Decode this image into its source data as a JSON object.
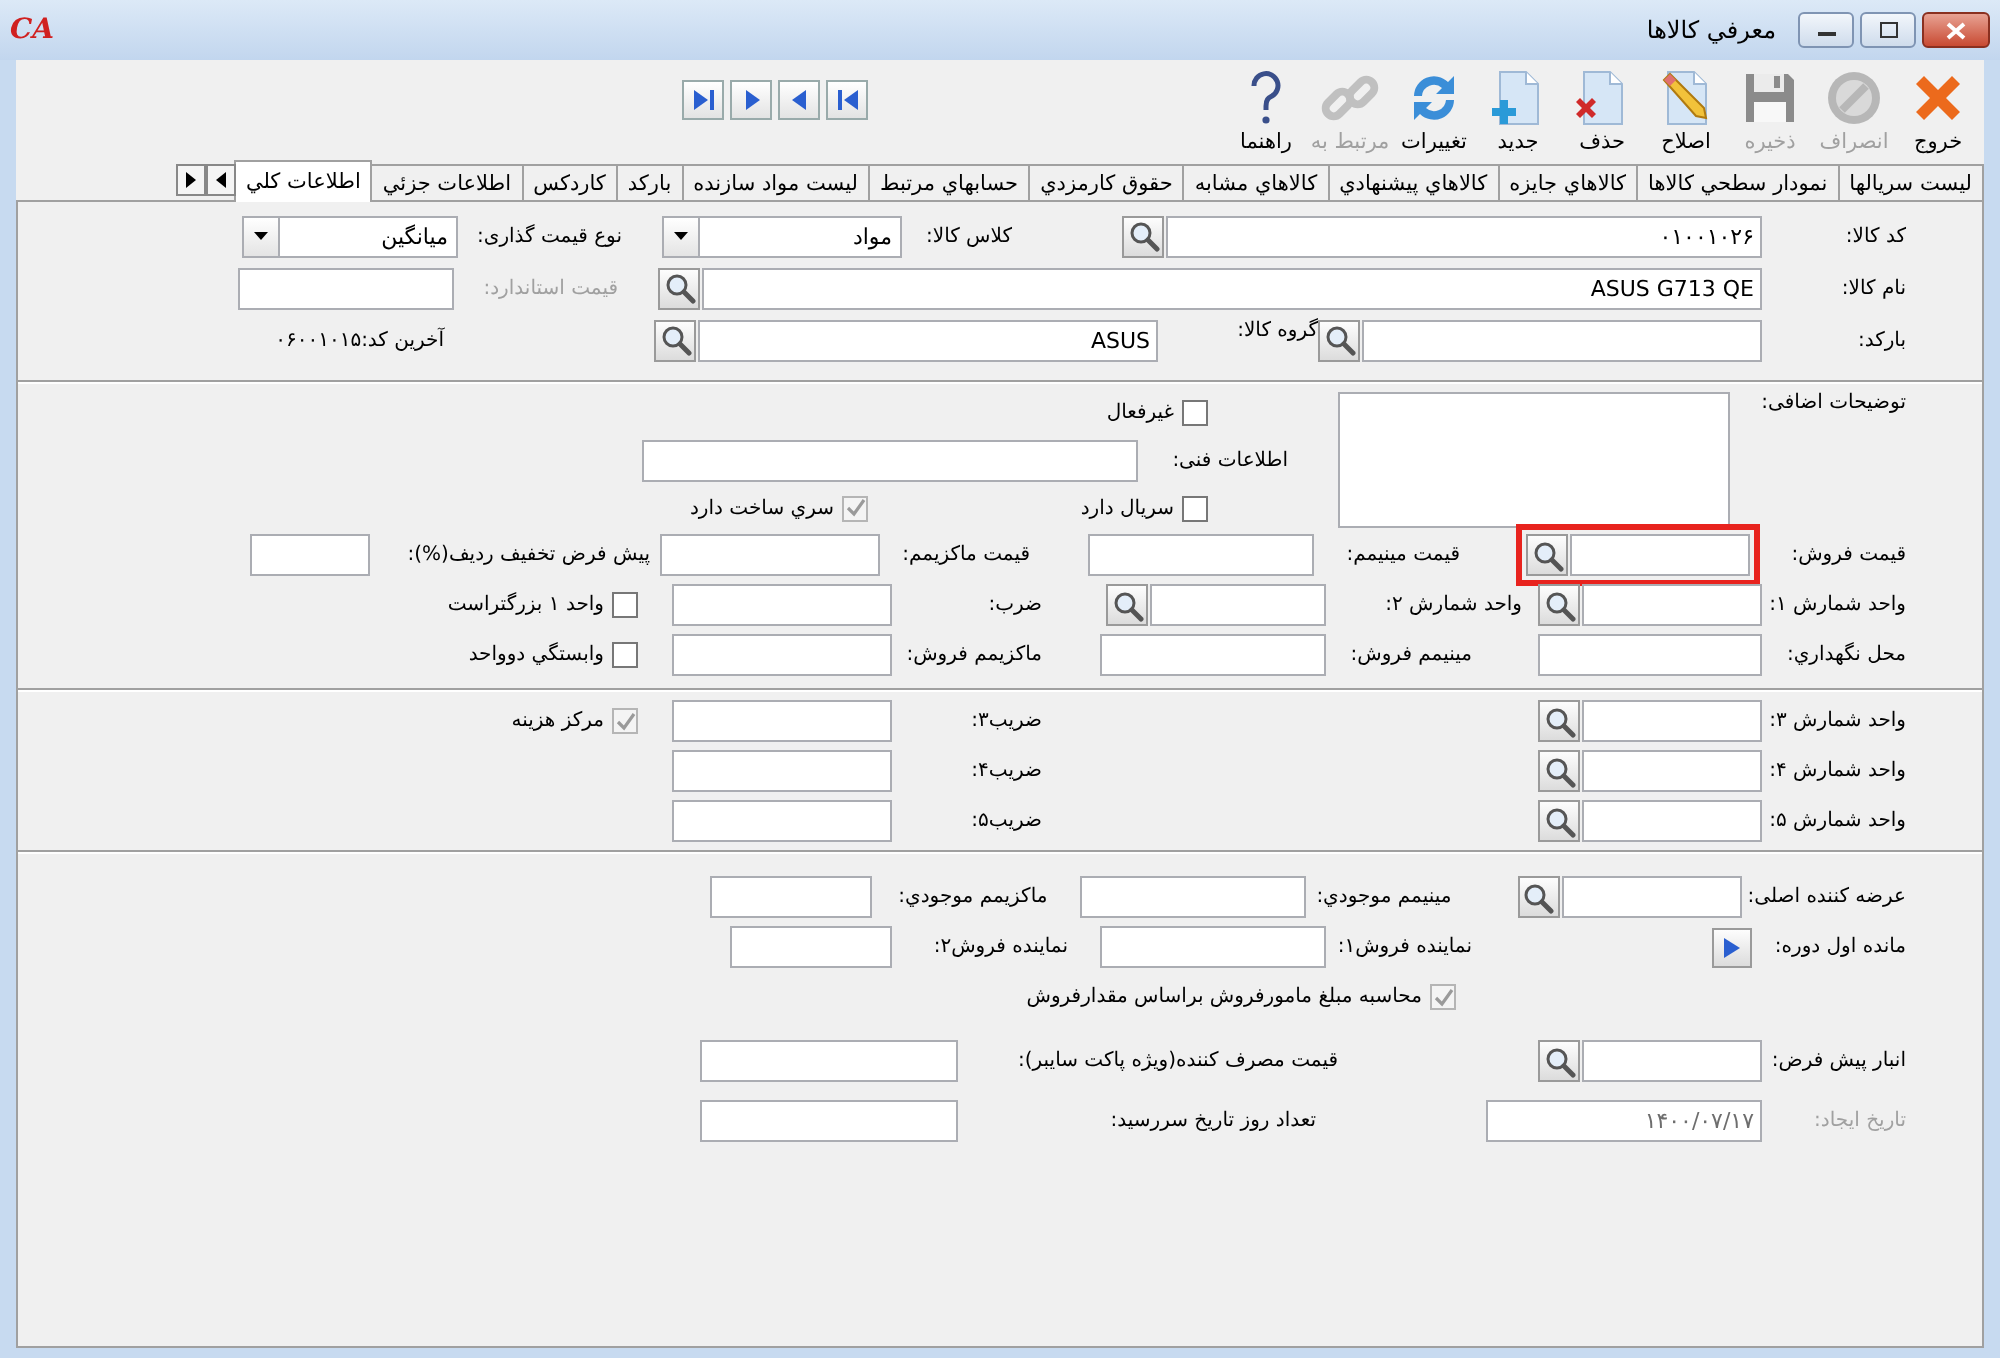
{
  "window": {
    "title": "معرفي كالاها",
    "logo": "CA"
  },
  "toolbar": [
    {
      "label": "خروج",
      "disabled": false
    },
    {
      "label": "انصراف",
      "disabled": true
    },
    {
      "label": "ذخیره",
      "disabled": true
    },
    {
      "label": "اصلاح",
      "disabled": false
    },
    {
      "label": "حذف",
      "disabled": false
    },
    {
      "label": "جدید",
      "disabled": false
    },
    {
      "label": "تغییرات",
      "disabled": false
    },
    {
      "label": "مرتبط به",
      "disabled": true
    },
    {
      "label": "راهنما",
      "disabled": false
    }
  ],
  "tabs": [
    {
      "label": "لیست سریالها",
      "selected": false
    },
    {
      "label": "نمودار سطحي كالاها",
      "selected": false
    },
    {
      "label": "كالاهاي جايزه",
      "selected": false
    },
    {
      "label": "كالاهاي پيشنهادي",
      "selected": false
    },
    {
      "label": "كالاهاي مشابه",
      "selected": false
    },
    {
      "label": "حقوق كارمزدي",
      "selected": false
    },
    {
      "label": "حسابهاي مرتبط",
      "selected": false
    },
    {
      "label": "ليست مواد سازنده",
      "selected": false
    },
    {
      "label": "باركد",
      "selected": false
    },
    {
      "label": "كاردكس",
      "selected": false
    },
    {
      "label": "اطلاعات جزئي",
      "selected": false
    },
    {
      "label": "اطلاعات كلي",
      "selected": true
    }
  ],
  "sections": [
    {
      "rows": [
        {
          "items": [
            {
              "kind": "field",
              "label": "کد کالا:",
              "value": "۰۱۰۰۱۰۲۶",
              "lookup": true,
              "disabled": false,
              "highlighted": false
            },
            {
              "kind": "combo",
              "label": "کلاس کالا:",
              "value": "مواد"
            },
            {
              "kind": "combo",
              "label": "نوع قیمت گذاری:",
              "value": "میانگین"
            }
          ]
        },
        {
          "items": [
            {
              "kind": "field",
              "label": "نام کالا:",
              "value": "ASUS G713 QE",
              "lookup": true,
              "disabled": false,
              "highlighted": false
            },
            {
              "kind": "field",
              "label": "قیمت استاندارد:",
              "lookup": false,
              "disabled": true,
              "highlighted": false
            }
          ]
        },
        {
          "items": [
            {
              "kind": "field",
              "label": "بارکد:",
              "lookup": true,
              "disabled": false,
              "highlighted": false
            },
            {
              "kind": "field",
              "label": "گروه کالا:",
              "value": "ASUS",
              "lookup": true,
              "disabled": false,
              "highlighted": false
            },
            {
              "kind": "text",
              "label": "آخرین کد:",
              "value": "۰۶۰۰۱۰۱۵"
            }
          ]
        }
      ]
    },
    {
      "side": {
        "kind": "textarea",
        "label": "توضیحات اضافی:"
      },
      "rows": [
        {
          "items": [
            {
              "kind": "checkbox",
              "label": "غیرفعال",
              "checked": false,
              "disabled": false
            }
          ]
        },
        {
          "items": [
            {
              "kind": "field",
              "label": "اطلاعات فنی:",
              "lookup": false,
              "disabled": false,
              "highlighted": false
            }
          ]
        },
        {
          "items": [
            {
              "kind": "checkbox",
              "label": "سریال دارد",
              "checked": false,
              "disabled": false
            },
            {
              "kind": "checkbox",
              "label": "سري ساخت دارد",
              "checked": true,
              "disabled": true
            }
          ]
        }
      ]
    },
    {
      "rows": [
        {
          "items": [
            {
              "kind": "field",
              "label": "قیمت فروش:",
              "lookup": true,
              "disabled": false,
              "highlighted": true
            },
            {
              "kind": "field",
              "label": "قیمت مینیمم:",
              "lookup": false,
              "disabled": false,
              "highlighted": false
            },
            {
              "kind": "field",
              "label": "قیمت ماکزیمم:",
              "lookup": false,
              "disabled": false,
              "highlighted": false
            },
            {
              "kind": "field",
              "label": "پیش فرض تخفیف ردیف(%):",
              "lookup": false,
              "disabled": false,
              "highlighted": false
            }
          ]
        },
        {
          "items": [
            {
              "kind": "field",
              "label": "واحد شمارش ۱:",
              "lookup": true,
              "disabled": false,
              "highlighted": false
            },
            {
              "kind": "field",
              "label": "واحد شمارش ۲:",
              "lookup": true,
              "disabled": false,
              "highlighted": false
            },
            {
              "kind": "field",
              "label": "ضرب:",
              "lookup": false,
              "disabled": false,
              "highlighted": false
            },
            {
              "kind": "checkbox",
              "label": "واحد ۱ بزرگتراست",
              "checked": false,
              "disabled": false
            }
          ]
        },
        {
          "items": [
            {
              "kind": "field",
              "label": "محل نگهداري:",
              "lookup": false,
              "disabled": false,
              "highlighted": false
            },
            {
              "kind": "field",
              "label": "مینیمم فروش:",
              "lookup": false,
              "disabled": false,
              "highlighted": false
            },
            {
              "kind": "field",
              "label": "ماکزیمم فروش:",
              "lookup": false,
              "disabled": false,
              "highlighted": false
            },
            {
              "kind": "checkbox",
              "label": "وابستگي دوواحد",
              "checked": false,
              "disabled": false
            }
          ]
        }
      ]
    },
    {
      "rows": [
        {
          "items": [
            {
              "kind": "field",
              "label": "واحد شمارش ۳:",
              "lookup": true,
              "disabled": false,
              "highlighted": false
            },
            {
              "kind": "field",
              "label": "ضریب۳:",
              "lookup": false,
              "disabled": false,
              "highlighted": false
            },
            {
              "kind": "checkbox",
              "label": "مرکز هزینه",
              "checked": true,
              "disabled": true
            }
          ]
        },
        {
          "items": [
            {
              "kind": "field",
              "label": "واحد شمارش ۴:",
              "lookup": true,
              "disabled": false,
              "highlighted": false
            },
            {
              "kind": "field",
              "label": "ضریب۴:",
              "lookup": false,
              "disabled": false,
              "highlighted": false
            }
          ]
        },
        {
          "items": [
            {
              "kind": "field",
              "label": "واحد شمارش ۵:",
              "lookup": true,
              "disabled": false,
              "highlighted": false
            },
            {
              "kind": "field",
              "label": "ضریب۵:",
              "lookup": false,
              "disabled": false,
              "highlighted": false
            }
          ]
        }
      ]
    },
    {
      "rows": [
        {
          "items": [
            {
              "kind": "field",
              "label": "عرضه کننده اصلی:",
              "lookup": true,
              "disabled": false,
              "highlighted": false
            },
            {
              "kind": "field",
              "label": "مینیمم موجودي:",
              "lookup": false,
              "disabled": false,
              "highlighted": false
            },
            {
              "kind": "field",
              "label": "ماکزیمم موجودي:",
              "lookup": false,
              "disabled": false,
              "highlighted": false
            }
          ]
        },
        {
          "items": [
            {
              "kind": "play",
              "label": "مانده اول دوره:"
            },
            {
              "kind": "field",
              "label": "نماینده فروش۱:",
              "lookup": false,
              "disabled": false,
              "highlighted": false
            },
            {
              "kind": "field",
              "label": "نماینده فروش۲:",
              "lookup": false,
              "disabled": false,
              "highlighted": false
            }
          ]
        },
        {
          "items": [
            {
              "kind": "checkbox",
              "label": "محاسبه مبلغ مامورفروش براساس مقدارفروش",
              "checked": true,
              "disabled": true
            }
          ]
        }
      ]
    },
    {
      "rows": [
        {
          "items": [
            {
              "kind": "field",
              "label": "انبار پیش فرض:",
              "lookup": true,
              "disabled": false,
              "highlighted": false
            },
            {
              "kind": "field",
              "label": "قیمت مصرف کننده(ویژه پاکت سایبر):",
              "lookup": false,
              "disabled": false,
              "highlighted": false
            }
          ]
        },
        {
          "items": [
            {
              "kind": "field",
              "label": "تاریخ ایجاد:",
              "value": "۱۴۰۰/۰۷/۱۷",
              "lookup": false,
              "disabled": true,
              "highlighted": false
            },
            {
              "kind": "field",
              "label": "تعداد روز تاریخ سررسید:",
              "lookup": false,
              "disabled": false,
              "highlighted": false
            }
          ]
        }
      ]
    }
  ]
}
